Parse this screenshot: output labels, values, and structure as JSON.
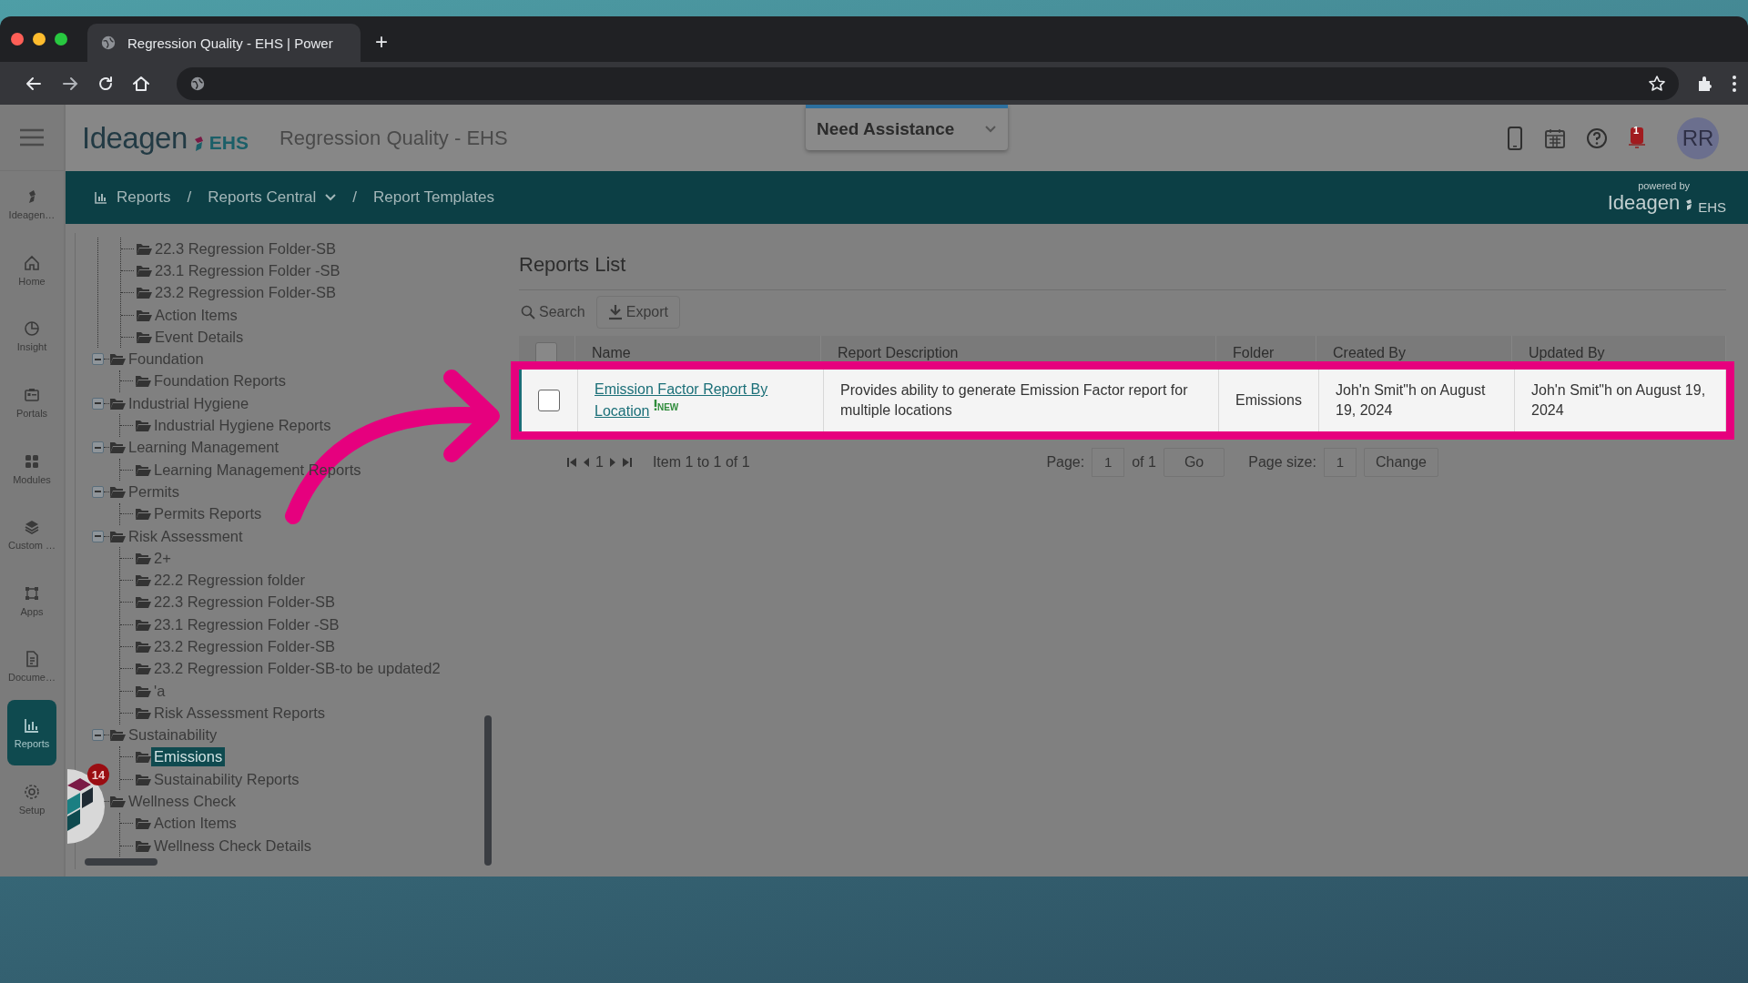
{
  "browser": {
    "tab_title": "Regression Quality - EHS | Power",
    "new_tab": "+"
  },
  "header": {
    "logo": "Ideagen",
    "logo_suffix": "EHS",
    "app_title": "Regression Quality - EHS",
    "assistance": "Need Assistance",
    "notification_count": "1",
    "avatar": "RR"
  },
  "rail": [
    {
      "label": "Ideagen…",
      "kind": "brand",
      "selected": false
    },
    {
      "label": "Home",
      "kind": "home",
      "selected": false
    },
    {
      "label": "Insight",
      "kind": "insight",
      "selected": false
    },
    {
      "label": "Portals",
      "kind": "portals",
      "selected": false
    },
    {
      "label": "Modules",
      "kind": "modules",
      "selected": false
    },
    {
      "label": "Custom …",
      "kind": "custom",
      "selected": false
    },
    {
      "label": "Apps",
      "kind": "apps",
      "selected": false
    },
    {
      "label": "Docume…",
      "kind": "documents",
      "selected": false
    },
    {
      "label": "Reports",
      "kind": "reports",
      "selected": true
    },
    {
      "label": "Setup",
      "kind": "setup",
      "selected": false
    }
  ],
  "breadcrumb": [
    {
      "label": "Reports",
      "kind": "icon"
    },
    {
      "label": "Reports Central",
      "kind": "dropdown",
      "separator": "/"
    },
    {
      "label": "Report Templates",
      "kind": "plain",
      "separator": "/"
    }
  ],
  "powered_by": {
    "caption": "powered by",
    "logo": "Ideagen",
    "suffix": "EHS"
  },
  "tree": {
    "continued_items": [
      {
        "label": "22.3 Regression Folder-SB",
        "selected": false
      },
      {
        "label": "23.1 Regression Folder -SB",
        "selected": false
      },
      {
        "label": "23.2 Regression Folder-SB",
        "selected": false
      },
      {
        "label": "Action Items",
        "selected": false
      },
      {
        "label": "Event Details",
        "selected": false
      }
    ],
    "nodes": [
      {
        "label": "Foundation",
        "expanded": true,
        "children": [
          {
            "label": "Foundation Reports",
            "selected": false
          }
        ]
      },
      {
        "label": "Industrial Hygiene",
        "expanded": true,
        "children": [
          {
            "label": "Industrial Hygiene Reports",
            "selected": false
          }
        ]
      },
      {
        "label": "Learning Management",
        "expanded": true,
        "children": [
          {
            "label": "Learning Management Reports",
            "selected": false
          }
        ]
      },
      {
        "label": "Permits",
        "expanded": true,
        "children": [
          {
            "label": "Permits Reports",
            "selected": false
          }
        ]
      },
      {
        "label": "Risk Assessment",
        "expanded": true,
        "children": [
          {
            "label": "2+",
            "selected": false
          },
          {
            "label": "22.2 Regression folder",
            "selected": false
          },
          {
            "label": "22.3 Regression Folder-SB",
            "selected": false
          },
          {
            "label": "23.1 Regression Folder -SB",
            "selected": false
          },
          {
            "label": "23.2 Regression Folder-SB",
            "selected": false
          },
          {
            "label": "23.2 Regression Folder-SB-to be updated2",
            "selected": false
          },
          {
            "label": "'a",
            "selected": false
          },
          {
            "label": "Risk Assessment Reports",
            "selected": false
          }
        ]
      },
      {
        "label": "Sustainability",
        "expanded": true,
        "children": [
          {
            "label": "Emissions",
            "selected": true
          },
          {
            "label": "Sustainability Reports",
            "selected": false
          }
        ]
      },
      {
        "label": "Wellness Check",
        "expanded": true,
        "children": [
          {
            "label": "Action Items",
            "selected": false
          },
          {
            "label": "Wellness Check Details",
            "selected": false
          }
        ]
      }
    ]
  },
  "reports": {
    "title": "Reports List",
    "search": "Search",
    "export": "Export",
    "header_checked": false,
    "columns": [
      "Name",
      "Report Description",
      "Folder",
      "Created By",
      "Updated By"
    ],
    "rows": [
      {
        "checked": false,
        "highlighted": true,
        "name": "Emission Factor Report By Location",
        "badge": "NEW",
        "description": "Provides ability to generate Emission Factor report for multiple locations",
        "folder": "Emissions",
        "created_by": "Joh'n Smit\"h on August 19, 2024",
        "updated_by": "Joh'n Smit\"h on August 19, 2024"
      }
    ]
  },
  "pager": {
    "current": "1",
    "range": "Item 1 to 1 of 1",
    "page_label": "Page:",
    "page_value": "1",
    "page_of": "of 1",
    "go": "Go",
    "size_label": "Page size:",
    "size_value": "1",
    "change": "Change"
  },
  "help_widget": {
    "count": "14"
  }
}
